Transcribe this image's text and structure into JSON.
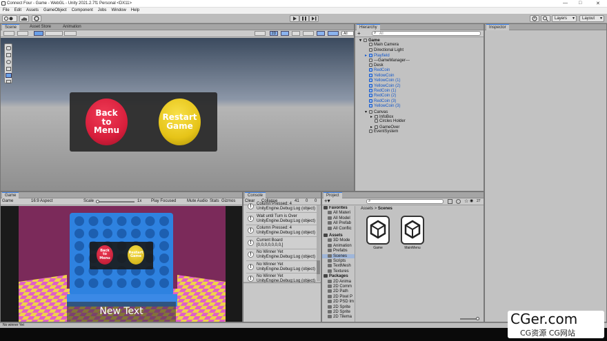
{
  "window": {
    "title": "Connect Four - Game - WebGL - Unity 2021.2.7f1 Personal <DX11>",
    "controls": [
      "—",
      "□",
      "✕"
    ]
  },
  "menu": [
    "File",
    "Edit",
    "Assets",
    "GameObject",
    "Component",
    "Jobs",
    "Window",
    "Help"
  ],
  "toolbar": {
    "play_icon": "play-icon",
    "pause_icon": "pause-icon",
    "step_icon": "step-icon",
    "layers_label": "Layers",
    "layout_label": "Layout"
  },
  "scene": {
    "tabs": [
      "Scene",
      "Asset Store",
      "Animation"
    ],
    "mode_2d": "2D",
    "all_label": "All",
    "buttons": {
      "back": [
        "Back",
        "to",
        "Menu"
      ],
      "restart": [
        "Restart",
        "Game"
      ]
    },
    "colors": {
      "back": "#d81f3c",
      "restart": "#e6c418"
    }
  },
  "hierarchy": {
    "tab": "Hierarchy",
    "search_placeholder": "All",
    "items": [
      {
        "label": "Game",
        "bold": true,
        "blue": false,
        "indent": 0,
        "arrow": "▾"
      },
      {
        "label": "Main Camera",
        "blue": false,
        "indent": 1,
        "arrow": ""
      },
      {
        "label": "Directional Light",
        "blue": false,
        "indent": 1,
        "arrow": ""
      },
      {
        "label": "Playfield",
        "blue": true,
        "indent": 1,
        "arrow": "▸"
      },
      {
        "label": "---GameManager---",
        "blue": false,
        "indent": 1,
        "arrow": ""
      },
      {
        "label": "Desk",
        "blue": false,
        "indent": 1,
        "arrow": ""
      },
      {
        "label": "RedCoin",
        "blue": true,
        "indent": 1,
        "arrow": ""
      },
      {
        "label": "YellowCoin",
        "blue": true,
        "indent": 1,
        "arrow": ""
      },
      {
        "label": "YellowCoin (1)",
        "blue": true,
        "indent": 1,
        "arrow": ""
      },
      {
        "label": "YellowCoin (2)",
        "blue": true,
        "indent": 1,
        "arrow": ""
      },
      {
        "label": "RedCoin (1)",
        "blue": true,
        "indent": 1,
        "arrow": ""
      },
      {
        "label": "RedCoin (2)",
        "blue": true,
        "indent": 1,
        "arrow": ""
      },
      {
        "label": "RedCoin (3)",
        "blue": true,
        "indent": 1,
        "arrow": ""
      },
      {
        "label": "YellowCoin (3)",
        "blue": true,
        "indent": 1,
        "arrow": ""
      },
      {
        "label": "Canvas",
        "blue": false,
        "indent": 1,
        "arrow": "▾"
      },
      {
        "label": "InfoBox",
        "blue": false,
        "indent": 2,
        "arrow": "▸"
      },
      {
        "label": "Circles Holder",
        "blue": false,
        "indent": 2,
        "arrow": ""
      },
      {
        "label": "GameOver",
        "blue": false,
        "indent": 2,
        "arrow": "▸"
      },
      {
        "label": "EventSystem",
        "blue": false,
        "indent": 1,
        "arrow": ""
      }
    ]
  },
  "inspector": {
    "tab": "Inspector"
  },
  "game": {
    "tab": "Game",
    "display": "Game",
    "aspect": "16:9 Aspect",
    "scale_label": "Scale",
    "scale_value": "1x",
    "play_focused": "Play Focused",
    "mute_audio": "Mute Audio",
    "stats": "Stats",
    "gizmos": "Gizmos",
    "mini_back": [
      "Back",
      "to",
      "Menu"
    ],
    "mini_restart": [
      "Restart",
      "Game"
    ],
    "new_text": "New Text"
  },
  "console": {
    "tab": "Console",
    "clear": "Clear",
    "collapse": "Collapse",
    "counts": {
      "info": "41",
      "warn": "0",
      "error": "0"
    },
    "entries": [
      {
        "l1": "Column Pressed: 4",
        "l2": "UnityEngine.Debug:Log (object)"
      },
      {
        "l1": "Wait until Turn is Over",
        "l2": "UnityEngine.Debug:Log (object)"
      },
      {
        "l1": "Column Pressed: 4",
        "l2": "UnityEngine.Debug:Log (object)"
      },
      {
        "l1": "Current Board",
        "l2": "[0,0,0,0,0,0,0,]"
      },
      {
        "l1": "No Winner Yet",
        "l2": "UnityEngine.Debug:Log (object)"
      },
      {
        "l1": "No Winner Yet",
        "l2": "UnityEngine.Debug:Log (object)"
      },
      {
        "l1": "No Winner Yet",
        "l2": "UnityEngine.Debug:Log (object)"
      }
    ]
  },
  "project": {
    "tab": "Project",
    "favorites_label": "Favorites",
    "favorites": [
      "All Materi",
      "All Model",
      "All Prefab",
      "All Conflic"
    ],
    "assets_label": "Assets",
    "asset_folders": [
      "3D Mode",
      "Animation",
      "Prefabs",
      "Scenes",
      "Scripts",
      "TextMesh",
      "Textures"
    ],
    "packages_label": "Packages",
    "packages": [
      "2D Anima",
      "2D Comm",
      "2D Path",
      "2D Pixel P",
      "2D PSD Im",
      "2D Sprite",
      "2D Sprite",
      "2D Tilema"
    ],
    "breadcrumb": [
      "Assets",
      "Scenes"
    ],
    "files": [
      "Game",
      "MainMenu"
    ],
    "count": "27"
  },
  "status": {
    "text": "No winner Yet"
  },
  "watermark": {
    "brand": "CGer.com",
    "sub": "CG资源 CG网站"
  }
}
